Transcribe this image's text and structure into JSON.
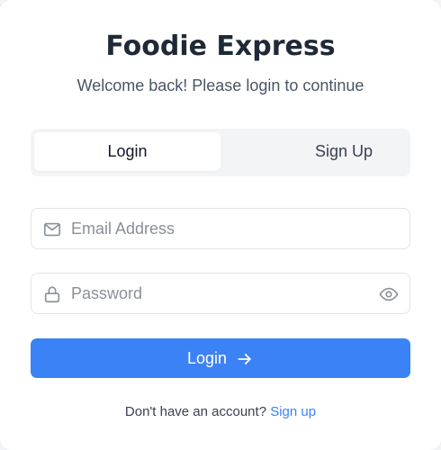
{
  "app": {
    "title": "Foodie Express",
    "subtitle": "Welcome back! Please login to continue"
  },
  "tabs": [
    {
      "label": "Login",
      "active": true
    },
    {
      "label": "Sign Up",
      "active": false
    }
  ],
  "form": {
    "email": {
      "placeholder": "Email Address",
      "value": "",
      "icon": "mail-icon"
    },
    "password": {
      "placeholder": "Password",
      "value": "",
      "icon": "lock-icon",
      "toggle_icon": "eye-icon"
    },
    "submit_label": "Login",
    "submit_icon": "arrow-right-icon"
  },
  "footer": {
    "prompt": "Don't have an account?",
    "link": "Sign up"
  },
  "colors": {
    "accent": "#3b82f6",
    "title": "#1f2937",
    "tab_track": "#f3f4f6",
    "border": "#e1e4e8"
  }
}
